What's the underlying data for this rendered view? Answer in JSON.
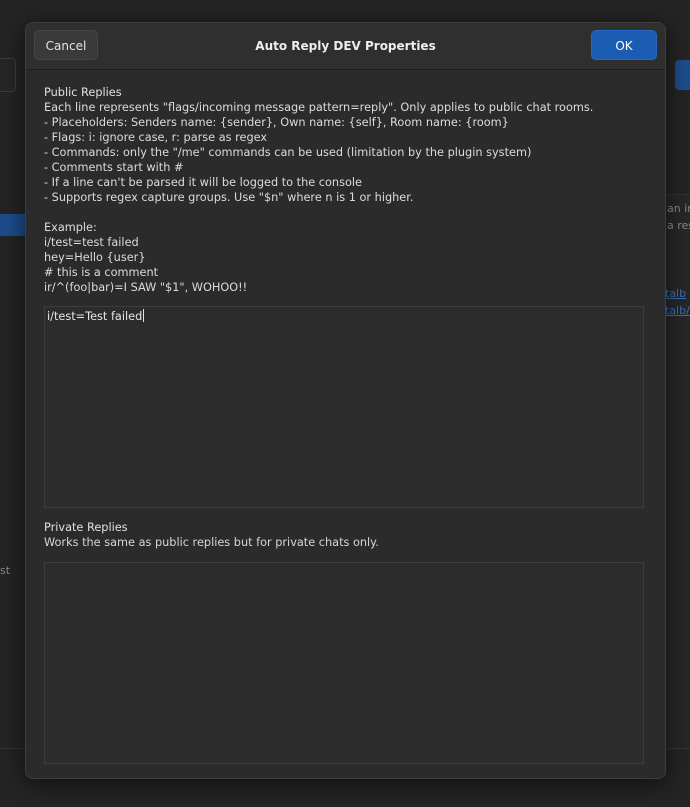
{
  "background": {
    "right_text_lines": [
      "an ir",
      "a res"
    ],
    "right_links": [
      "talb",
      "talb/"
    ],
    "left_text": "st"
  },
  "dialog": {
    "title": "Auto Reply DEV Properties",
    "cancel_label": "Cancel",
    "ok_label": "OK",
    "accent_color": "#1b5cb3"
  },
  "public_replies": {
    "heading": "Public Replies",
    "description_lines": [
      "Each line represents \"flags/incoming message pattern=reply\". Only applies to public chat rooms.",
      "- Placeholders: Senders name: {sender}, Own name: {self}, Room name: {room}",
      "- Flags: i: ignore case, r: parse as regex",
      "- Commands: only the \"/me\" commands can be used (limitation by the plugin system)",
      "- Comments start with #",
      "- If a line can't be parsed it will be logged to the console",
      "- Supports regex capture groups. Use \"$n\" where n is 1 or higher."
    ],
    "example_heading": "Example:",
    "example_lines": [
      "i/test=test failed",
      "hey=Hello {user}",
      "# this is a comment",
      "ir/^(foo|bar)=I SAW \"$1\", WOHOO!!"
    ],
    "textarea_value": "i/test=Test failed"
  },
  "private_replies": {
    "heading": "Private Replies",
    "description": "Works the same as public replies but for private chats only.",
    "textarea_value": ""
  }
}
